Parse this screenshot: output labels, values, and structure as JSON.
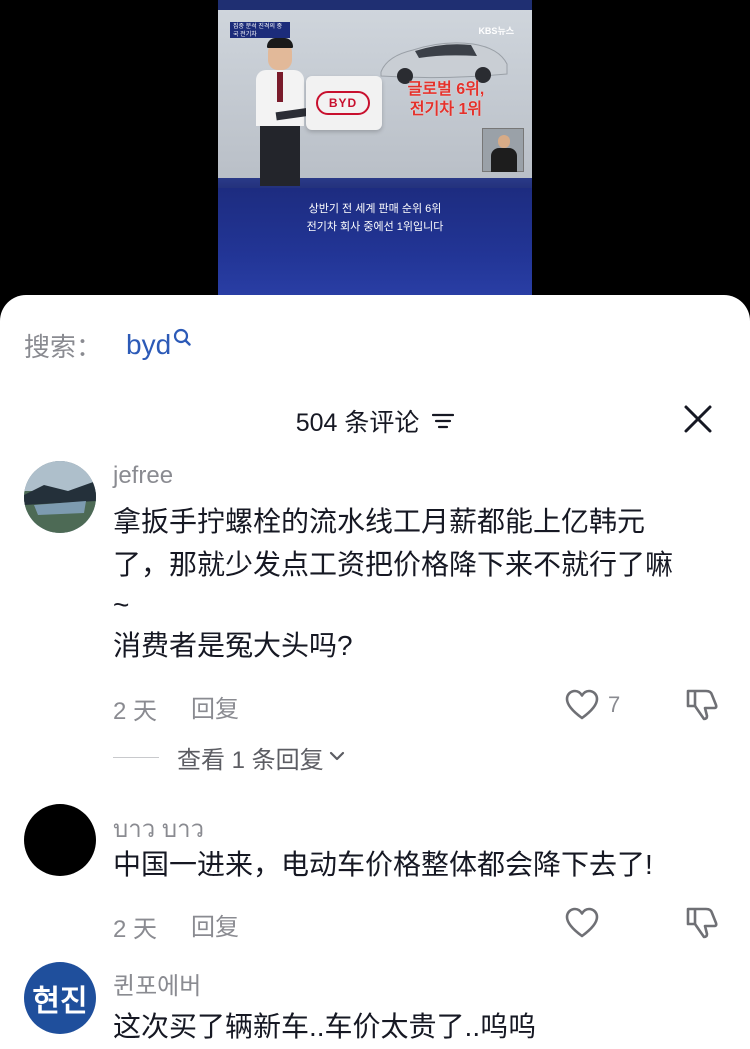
{
  "video": {
    "chyron": "집중 분석 진격의 중국 전기차",
    "network": "KBS뉴스",
    "brand": "BYD",
    "headline_line1": "글로벌 6위,",
    "headline_line2": "전기차 1위",
    "subtitle_line1": "상반기 전 세계 판매 순위 6위",
    "subtitle_line2": "전기차 회사 중에선 1위입니다"
  },
  "search": {
    "label": "搜索：",
    "term": "byd",
    "icon": "search-icon"
  },
  "comments_header": {
    "title": "504 条评论",
    "sort_icon": "filter-sort-icon",
    "close_icon": "close-icon"
  },
  "comments": [
    {
      "author": "jefree",
      "text_line1": "拿扳手拧螺栓的流水线工月薪都能上亿韩元",
      "text_line2": "了，那就少发点工资把价格降下来不就行了嘛",
      "text_line3": "~",
      "text_line4": "消费者是冤大头吗?",
      "time": "2 天",
      "reply": "回复",
      "likes": "7",
      "view_replies": "查看 1 条回复"
    },
    {
      "author": "บาว บาว",
      "text_line1": "中国一进来，电动车价格整体都会降下去了!",
      "time": "2 天",
      "reply": "回复"
    },
    {
      "author": "퀸포에버",
      "avatar_text": "현진",
      "text_line1": "这次买了辆新车..车价太贵了..呜呜"
    }
  ],
  "colors": {
    "link_blue": "#2c5ab7",
    "muted_gray": "#8a8b91",
    "avatar_blue": "#1f4f9c"
  }
}
